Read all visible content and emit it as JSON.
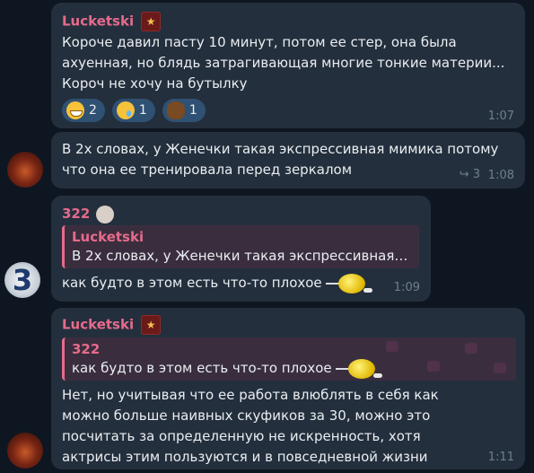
{
  "messages": [
    {
      "author": "Lucketski",
      "author_badge": "★",
      "author_color": "#e56b8c",
      "text": "Короче давил пасту 10 минут, потом ее стер, она была ахуенная, но блядь затрагивающая многие тонкие материи... Короч не хочу на бутылку",
      "reactions": [
        {
          "emoji": "grinning-face",
          "count": "2"
        },
        {
          "emoji": "crying-face",
          "count": "1"
        },
        {
          "emoji": "pile-of-poo",
          "count": "1"
        }
      ],
      "time": "1:07"
    },
    {
      "text": "В 2х словах, у Женечки такая экспрессивная мимика потому что она ее тренировала перед зеркалом",
      "forwards": "3",
      "time": "1:08",
      "avatar": "beast-avatar"
    },
    {
      "author": "322",
      "author_color": "#e56b8c",
      "reply": {
        "author": "Lucketski",
        "text": "В 2х словах, у Женечки такая экспрессивная м..."
      },
      "text": "как будто в этом есть что-то плохое",
      "time": "1:09",
      "avatar": "number-three-avatar"
    },
    {
      "author": "Lucketski",
      "author_badge": "★",
      "author_color": "#e56b8c",
      "reply": {
        "author": "322",
        "text": "как будто в этом есть что-то плохое"
      },
      "text": "Нет, но учитывая что ее работа влюблять в себя как можно больше наивных скуфиков за 30, можно это посчитать за определенную не искренность, хотя актрисы этим пользуются и в повседневной жизни",
      "time": "1:11",
      "avatar": "beast-avatar"
    }
  ]
}
